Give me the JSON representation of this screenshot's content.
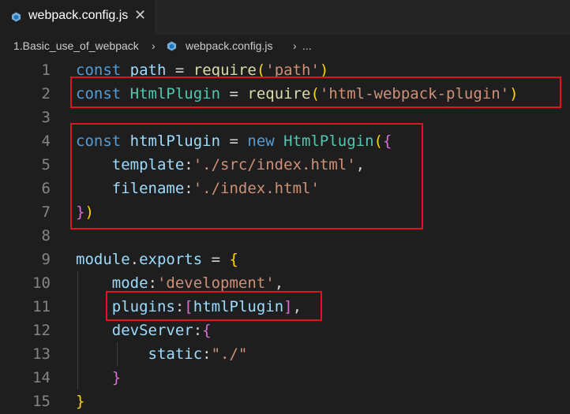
{
  "tab": {
    "label": "webpack.config.js",
    "close": "✕"
  },
  "breadcrumb": {
    "folder": "1.Basic_use_of_webpack",
    "sep1": "›",
    "file": "webpack.config.js",
    "sep2": "›",
    "more": "..."
  },
  "colors": {
    "highlight_box": "#e0141e",
    "keyword": "#569cd6",
    "string": "#ce9178",
    "class": "#4ec9b0"
  },
  "icons": {
    "file_icon": "webpack-cube-icon"
  },
  "lines": [
    {
      "num": "1",
      "tokens": [
        [
          "kw",
          "const"
        ],
        [
          "p",
          " "
        ],
        [
          "var",
          "path"
        ],
        [
          "p",
          " = "
        ],
        [
          "fn",
          "require"
        ],
        [
          "b1",
          "("
        ],
        [
          "str",
          "'path'"
        ],
        [
          "b1",
          ")"
        ]
      ]
    },
    {
      "num": "2",
      "tokens": [
        [
          "kw",
          "const"
        ],
        [
          "p",
          " "
        ],
        [
          "cls",
          "HtmlPlugin"
        ],
        [
          "p",
          " = "
        ],
        [
          "fn",
          "require"
        ],
        [
          "b1",
          "("
        ],
        [
          "str",
          "'html-webpack-plugin'"
        ],
        [
          "b1",
          ")"
        ]
      ]
    },
    {
      "num": "3",
      "tokens": []
    },
    {
      "num": "4",
      "tokens": [
        [
          "kw",
          "const"
        ],
        [
          "p",
          " "
        ],
        [
          "var",
          "htmlPlugin"
        ],
        [
          "p",
          " = "
        ],
        [
          "kw",
          "new"
        ],
        [
          "p",
          " "
        ],
        [
          "cls",
          "HtmlPlugin"
        ],
        [
          "b1",
          "("
        ],
        [
          "b2",
          "{"
        ]
      ]
    },
    {
      "num": "5",
      "tokens": [
        [
          "p",
          "    "
        ],
        [
          "var",
          "template"
        ],
        [
          "p",
          ":"
        ],
        [
          "str",
          "'./src/index.html'"
        ],
        [
          "p",
          ","
        ]
      ]
    },
    {
      "num": "6",
      "tokens": [
        [
          "p",
          "    "
        ],
        [
          "var",
          "filename"
        ],
        [
          "p",
          ":"
        ],
        [
          "str",
          "'./index.html'"
        ]
      ]
    },
    {
      "num": "7",
      "tokens": [
        [
          "b2",
          "}"
        ],
        [
          "b1",
          ")"
        ]
      ]
    },
    {
      "num": "8",
      "tokens": []
    },
    {
      "num": "9",
      "tokens": [
        [
          "var",
          "module"
        ],
        [
          "p",
          "."
        ],
        [
          "var",
          "exports"
        ],
        [
          "p",
          " = "
        ],
        [
          "b1",
          "{"
        ]
      ]
    },
    {
      "num": "10",
      "tokens": [
        [
          "p",
          "    "
        ],
        [
          "var",
          "mode"
        ],
        [
          "p",
          ":"
        ],
        [
          "str",
          "'development'"
        ],
        [
          "p",
          ","
        ]
      ]
    },
    {
      "num": "11",
      "tokens": [
        [
          "p",
          "    "
        ],
        [
          "var",
          "plugins"
        ],
        [
          "p",
          ":"
        ],
        [
          "b2",
          "["
        ],
        [
          "var",
          "htmlPlugin"
        ],
        [
          "b2",
          "]"
        ],
        [
          "p",
          ","
        ]
      ]
    },
    {
      "num": "12",
      "tokens": [
        [
          "p",
          "    "
        ],
        [
          "var",
          "devServer"
        ],
        [
          "p",
          ":"
        ],
        [
          "b2",
          "{"
        ]
      ]
    },
    {
      "num": "13",
      "tokens": [
        [
          "p",
          "        "
        ],
        [
          "var",
          "static"
        ],
        [
          "p",
          ":"
        ],
        [
          "str",
          "\"./\""
        ]
      ]
    },
    {
      "num": "14",
      "tokens": [
        [
          "p",
          "    "
        ],
        [
          "b2",
          "}"
        ]
      ]
    },
    {
      "num": "15",
      "tokens": [
        [
          "b1",
          "}"
        ]
      ]
    }
  ]
}
